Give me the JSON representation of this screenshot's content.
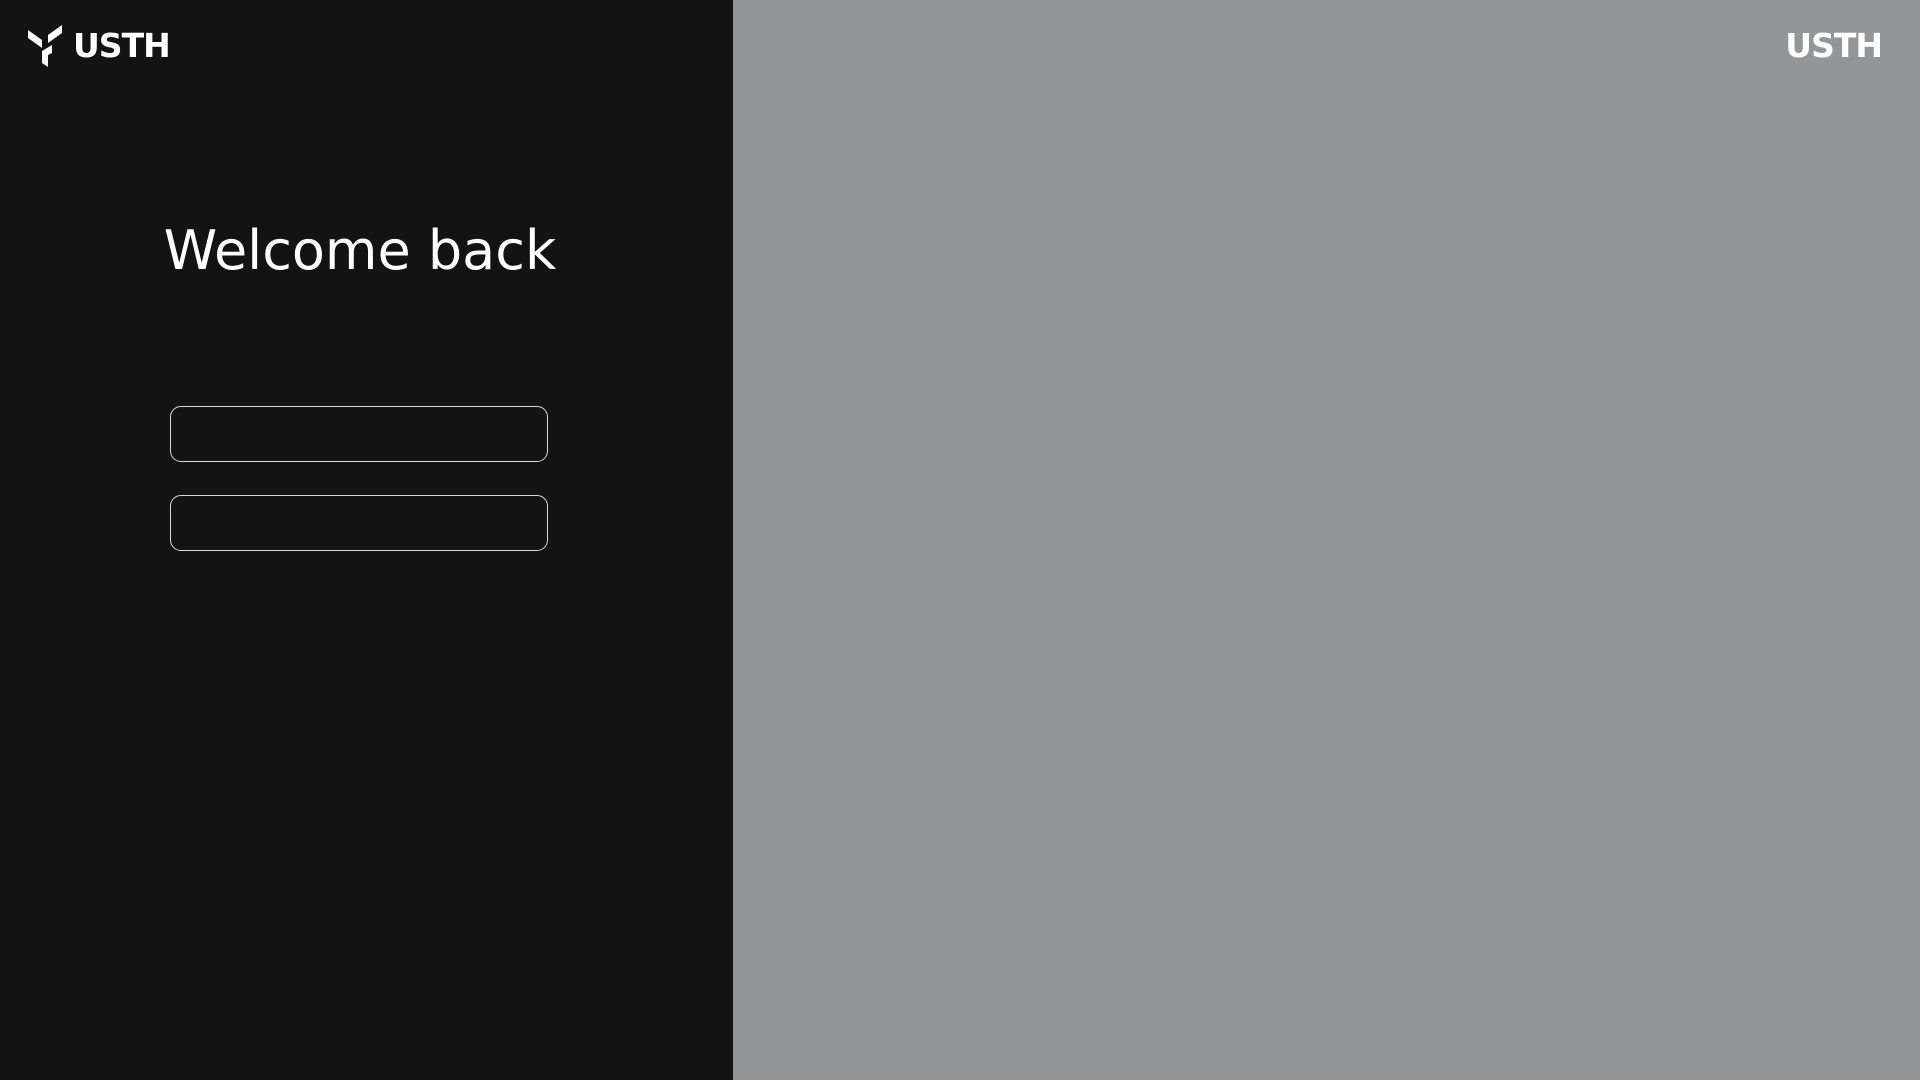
{
  "brand": {
    "left_wordmark": "USTH",
    "right_wordmark": "USTH",
    "logo_icon": "usth-logo-icon"
  },
  "login": {
    "title": "Welcome back",
    "field_1": {
      "value": "",
      "placeholder": ""
    },
    "field_2": {
      "value": "",
      "placeholder": ""
    }
  },
  "colors": {
    "left_panel_bg": "#131313",
    "right_panel_bg": "#949596",
    "text": "#ffffff",
    "field_border": "#d8d8d8"
  }
}
